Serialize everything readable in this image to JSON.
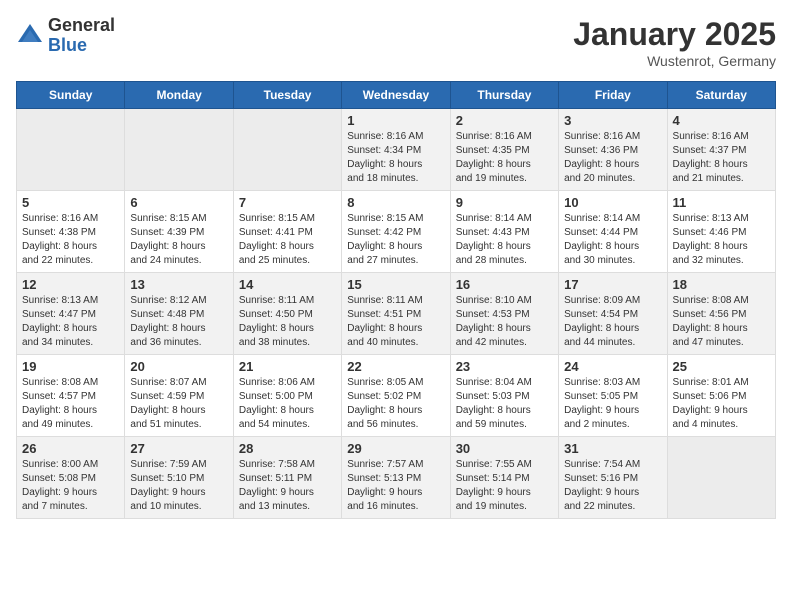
{
  "header": {
    "logo_general": "General",
    "logo_blue": "Blue",
    "title": "January 2025",
    "location": "Wustenrot, Germany"
  },
  "weekdays": [
    "Sunday",
    "Monday",
    "Tuesday",
    "Wednesday",
    "Thursday",
    "Friday",
    "Saturday"
  ],
  "weeks": [
    [
      {
        "day": "",
        "info": ""
      },
      {
        "day": "",
        "info": ""
      },
      {
        "day": "",
        "info": ""
      },
      {
        "day": "1",
        "info": "Sunrise: 8:16 AM\nSunset: 4:34 PM\nDaylight: 8 hours\nand 18 minutes."
      },
      {
        "day": "2",
        "info": "Sunrise: 8:16 AM\nSunset: 4:35 PM\nDaylight: 8 hours\nand 19 minutes."
      },
      {
        "day": "3",
        "info": "Sunrise: 8:16 AM\nSunset: 4:36 PM\nDaylight: 8 hours\nand 20 minutes."
      },
      {
        "day": "4",
        "info": "Sunrise: 8:16 AM\nSunset: 4:37 PM\nDaylight: 8 hours\nand 21 minutes."
      }
    ],
    [
      {
        "day": "5",
        "info": "Sunrise: 8:16 AM\nSunset: 4:38 PM\nDaylight: 8 hours\nand 22 minutes."
      },
      {
        "day": "6",
        "info": "Sunrise: 8:15 AM\nSunset: 4:39 PM\nDaylight: 8 hours\nand 24 minutes."
      },
      {
        "day": "7",
        "info": "Sunrise: 8:15 AM\nSunset: 4:41 PM\nDaylight: 8 hours\nand 25 minutes."
      },
      {
        "day": "8",
        "info": "Sunrise: 8:15 AM\nSunset: 4:42 PM\nDaylight: 8 hours\nand 27 minutes."
      },
      {
        "day": "9",
        "info": "Sunrise: 8:14 AM\nSunset: 4:43 PM\nDaylight: 8 hours\nand 28 minutes."
      },
      {
        "day": "10",
        "info": "Sunrise: 8:14 AM\nSunset: 4:44 PM\nDaylight: 8 hours\nand 30 minutes."
      },
      {
        "day": "11",
        "info": "Sunrise: 8:13 AM\nSunset: 4:46 PM\nDaylight: 8 hours\nand 32 minutes."
      }
    ],
    [
      {
        "day": "12",
        "info": "Sunrise: 8:13 AM\nSunset: 4:47 PM\nDaylight: 8 hours\nand 34 minutes."
      },
      {
        "day": "13",
        "info": "Sunrise: 8:12 AM\nSunset: 4:48 PM\nDaylight: 8 hours\nand 36 minutes."
      },
      {
        "day": "14",
        "info": "Sunrise: 8:11 AM\nSunset: 4:50 PM\nDaylight: 8 hours\nand 38 minutes."
      },
      {
        "day": "15",
        "info": "Sunrise: 8:11 AM\nSunset: 4:51 PM\nDaylight: 8 hours\nand 40 minutes."
      },
      {
        "day": "16",
        "info": "Sunrise: 8:10 AM\nSunset: 4:53 PM\nDaylight: 8 hours\nand 42 minutes."
      },
      {
        "day": "17",
        "info": "Sunrise: 8:09 AM\nSunset: 4:54 PM\nDaylight: 8 hours\nand 44 minutes."
      },
      {
        "day": "18",
        "info": "Sunrise: 8:08 AM\nSunset: 4:56 PM\nDaylight: 8 hours\nand 47 minutes."
      }
    ],
    [
      {
        "day": "19",
        "info": "Sunrise: 8:08 AM\nSunset: 4:57 PM\nDaylight: 8 hours\nand 49 minutes."
      },
      {
        "day": "20",
        "info": "Sunrise: 8:07 AM\nSunset: 4:59 PM\nDaylight: 8 hours\nand 51 minutes."
      },
      {
        "day": "21",
        "info": "Sunrise: 8:06 AM\nSunset: 5:00 PM\nDaylight: 8 hours\nand 54 minutes."
      },
      {
        "day": "22",
        "info": "Sunrise: 8:05 AM\nSunset: 5:02 PM\nDaylight: 8 hours\nand 56 minutes."
      },
      {
        "day": "23",
        "info": "Sunrise: 8:04 AM\nSunset: 5:03 PM\nDaylight: 8 hours\nand 59 minutes."
      },
      {
        "day": "24",
        "info": "Sunrise: 8:03 AM\nSunset: 5:05 PM\nDaylight: 9 hours\nand 2 minutes."
      },
      {
        "day": "25",
        "info": "Sunrise: 8:01 AM\nSunset: 5:06 PM\nDaylight: 9 hours\nand 4 minutes."
      }
    ],
    [
      {
        "day": "26",
        "info": "Sunrise: 8:00 AM\nSunset: 5:08 PM\nDaylight: 9 hours\nand 7 minutes."
      },
      {
        "day": "27",
        "info": "Sunrise: 7:59 AM\nSunset: 5:10 PM\nDaylight: 9 hours\nand 10 minutes."
      },
      {
        "day": "28",
        "info": "Sunrise: 7:58 AM\nSunset: 5:11 PM\nDaylight: 9 hours\nand 13 minutes."
      },
      {
        "day": "29",
        "info": "Sunrise: 7:57 AM\nSunset: 5:13 PM\nDaylight: 9 hours\nand 16 minutes."
      },
      {
        "day": "30",
        "info": "Sunrise: 7:55 AM\nSunset: 5:14 PM\nDaylight: 9 hours\nand 19 minutes."
      },
      {
        "day": "31",
        "info": "Sunrise: 7:54 AM\nSunset: 5:16 PM\nDaylight: 9 hours\nand 22 minutes."
      },
      {
        "day": "",
        "info": ""
      }
    ]
  ]
}
